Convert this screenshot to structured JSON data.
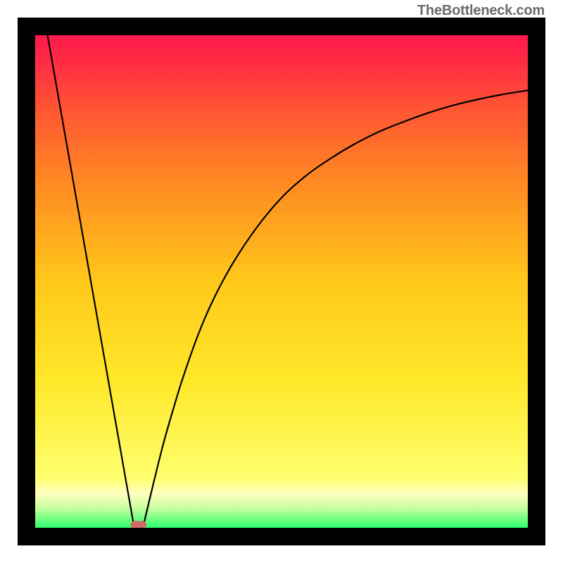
{
  "attribution": "TheBottleneck.com",
  "chart_data": {
    "type": "line",
    "title": "",
    "xlabel": "",
    "ylabel": "",
    "xlim": [
      0,
      100
    ],
    "ylim": [
      0,
      100
    ],
    "grid": false,
    "legend": false,
    "background_gradient": {
      "stops": [
        {
          "offset": 0.0,
          "color": "#ff1a4d"
        },
        {
          "offset": 0.05,
          "color": "#ff2a44"
        },
        {
          "offset": 0.15,
          "color": "#ff5533"
        },
        {
          "offset": 0.3,
          "color": "#ff8a22"
        },
        {
          "offset": 0.5,
          "color": "#ffc81a"
        },
        {
          "offset": 0.7,
          "color": "#ffe82a"
        },
        {
          "offset": 0.8,
          "color": "#fff34a"
        },
        {
          "offset": 0.9,
          "color": "#ffff70"
        },
        {
          "offset": 0.93,
          "color": "#ffffc0"
        },
        {
          "offset": 0.96,
          "color": "#c8ffa0"
        },
        {
          "offset": 1.0,
          "color": "#2bff6a"
        }
      ]
    },
    "series": [
      {
        "name": "left-branch",
        "type": "line",
        "x": [
          2.5,
          20.0
        ],
        "y": [
          100.0,
          0.6
        ]
      },
      {
        "name": "right-branch",
        "type": "line",
        "x": [
          22.0,
          24.0,
          26.0,
          28.0,
          30.0,
          33.0,
          36.0,
          40.0,
          45.0,
          50.0,
          55.0,
          60.0,
          65.0,
          70.0,
          75.0,
          80.0,
          85.0,
          90.0,
          95.0,
          100.0
        ],
        "y": [
          0.6,
          9.0,
          17.0,
          24.0,
          30.5,
          39.0,
          46.0,
          53.5,
          61.0,
          67.0,
          71.5,
          75.0,
          78.0,
          80.5,
          82.5,
          84.3,
          85.8,
          87.0,
          88.0,
          88.8
        ]
      }
    ],
    "marker": {
      "x": 21.0,
      "y": 0.6,
      "rx": 1.6,
      "ry": 0.8,
      "color": "#d36a6a"
    }
  }
}
